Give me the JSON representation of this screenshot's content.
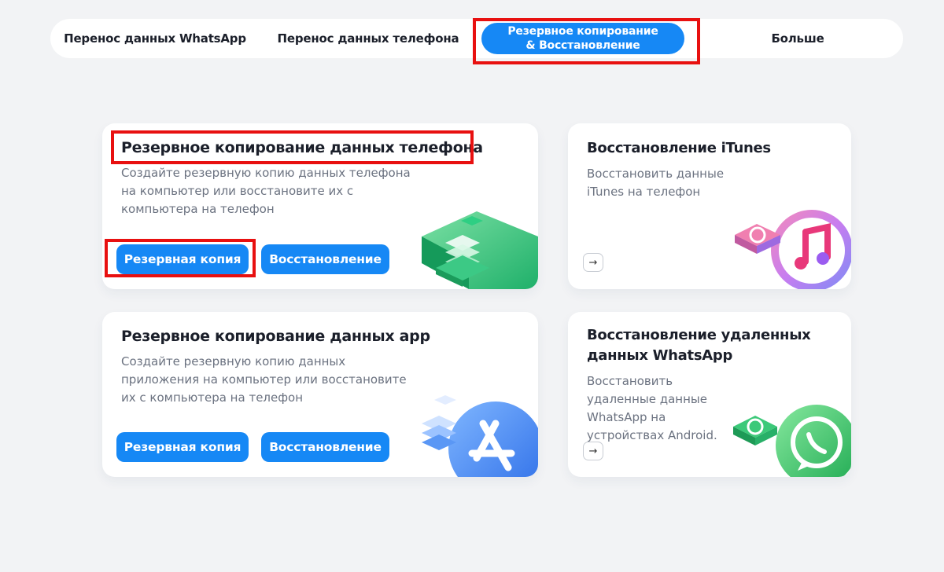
{
  "nav": {
    "tabs": [
      {
        "label": "Перенос данных WhatsApp"
      },
      {
        "label": "Перенос данных телефона"
      },
      {
        "label_line1": "Резервное копирование",
        "label_line2": "& Восстановление"
      },
      {
        "label": "Больше"
      }
    ]
  },
  "cards": {
    "phone_backup": {
      "title": "Резервное копирование данных телефона",
      "desc_lines": [
        "Создайте резервную копию данных телефона",
        "на компьютер или восстановите их с",
        "компьютера на телефон"
      ],
      "backup_label": "Резервная копия",
      "restore_label": "Восстановление"
    },
    "itunes_restore": {
      "title": "Восстановление iTunes",
      "desc_lines": [
        "Восстановить данные",
        "iTunes на телефон"
      ],
      "arrow": "→"
    },
    "app_backup": {
      "title": "Резервное копирование данных app",
      "desc_lines": [
        "Создайте резервную копию данных",
        "приложения на компьютер или восстановите",
        "их с компьютера на телефон"
      ],
      "backup_label": "Резервная копия",
      "restore_label": "Восстановление"
    },
    "whatsapp_restore": {
      "title_lines": [
        "Восстановление удаленных",
        "данных WhatsApp"
      ],
      "desc_lines": [
        "Восстановить",
        "удаленные данные",
        "WhatsApp на",
        "устройствах Android."
      ],
      "arrow": "→"
    }
  },
  "colors": {
    "accent": "#1688f5",
    "highlight": "#e81010",
    "background": "#f2f3f5"
  },
  "icons": [
    "phone-backup-illustration",
    "itunes-illustration",
    "app-store-illustration",
    "whatsapp-illustration",
    "arrow-right-icon"
  ]
}
